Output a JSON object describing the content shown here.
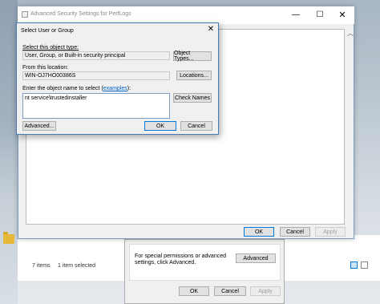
{
  "select_dialog": {
    "title": "Select User or Group",
    "object_type_label": "Select this object type:",
    "object_type_value": "User, Group, or Built-in security principal",
    "object_types_button": "Object Types...",
    "location_label": "From this location:",
    "location_value": "WIN-OJ7HO00386S",
    "locations_button": "Locations...",
    "enter_label": "Enter the object name to select (",
    "examples_link": "examples",
    "enter_label_end": "):",
    "enter_value": "nt service\\trustedinstaller",
    "check_names_button": "Check Names",
    "advanced_button": "Advanced...",
    "ok_button": "OK",
    "cancel_button": "Cancel",
    "close_glyph": "✕"
  },
  "advanced_window": {
    "title": "Advanced Security Settings for PerfLogs",
    "minimize_glyph": "—",
    "maximize_glyph": "☐",
    "close_glyph": "✕",
    "chevron_glyph": "︿",
    "ok_button": "OK",
    "cancel_button": "Cancel",
    "apply_button": "Apply"
  },
  "properties_window": {
    "special_text": "For special permissions or advanced settings, click Advanced.",
    "advanced_button": "Advanced",
    "ok_button": "OK",
    "cancel_button": "Cancel",
    "apply_button": "Apply"
  },
  "explorer": {
    "item_count": "7 items",
    "selection": "1 item selected"
  },
  "colors": {
    "accent": "#0078d7",
    "link": "#0066cc",
    "dialog_bg": "#f0f0f0"
  }
}
